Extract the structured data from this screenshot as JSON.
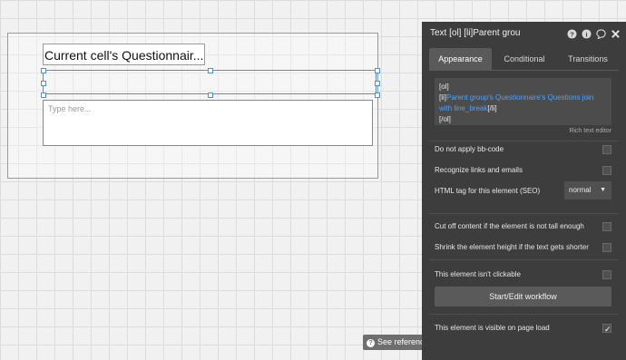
{
  "canvas": {
    "title_text": "Current cell's Questionnair...",
    "input_placeholder": "Type here...",
    "see_reference": "See reference →"
  },
  "panel": {
    "title": "Text [ol] [li]Parent grou",
    "icons": [
      "help-icon",
      "info-icon",
      "comment-icon",
      "close-icon"
    ],
    "tabs": [
      {
        "label": "Appearance",
        "active": true
      },
      {
        "label": "Conditional",
        "active": false
      },
      {
        "label": "Transitions",
        "active": false
      }
    ],
    "content": {
      "line1": "[ol]",
      "line2_prefix": "[li]",
      "line2_dynamic": "Parent group's Questionnaire's Questions join with line_break",
      "line2_suffix": "[/li]",
      "line3": "[/ol]"
    },
    "rich_text_editor": "Rich text editor",
    "options": {
      "bbcode": "Do not apply bb-code",
      "links": "Recognize links and emails",
      "html_tag_label": "HTML tag for this element (SEO)",
      "html_tag_value": "normal",
      "cut_off": "Cut off content if the element is not tall enough",
      "shrink": "Shrink the element height if the text gets shorter",
      "not_clickable": "This element isn't clickable",
      "workflow_button": "Start/Edit workflow",
      "visible": "This element is visible on page load"
    },
    "visible_checked": true,
    "accent_color": "#4aa3ff"
  }
}
